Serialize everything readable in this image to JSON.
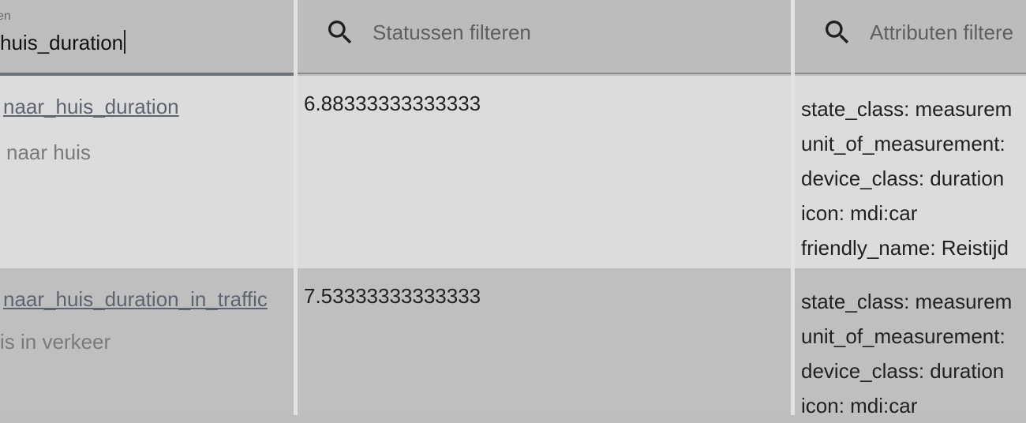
{
  "columns": {
    "entity": {
      "floating_label": "en",
      "filter_value": "huis_duration"
    },
    "state": {
      "filter_placeholder": "Statussen filteren",
      "icon": "search-icon"
    },
    "attributes": {
      "filter_placeholder": "Attributen filtere",
      "icon": "search-icon"
    }
  },
  "rows": [
    {
      "entity_id": "naar_huis_duration",
      "friendly_name": "naar huis",
      "state": "6.88333333333333",
      "attributes": [
        "state_class: measurem",
        "unit_of_measurement:",
        "device_class: duration",
        "icon: mdi:car",
        "friendly_name: Reistijd"
      ]
    },
    {
      "entity_id": "naar_huis_duration_in_traffic",
      "friendly_name": "is in verkeer",
      "state": "7.53333333333333",
      "attributes": [
        "state_class: measurem",
        "unit_of_measurement:",
        "device_class: duration",
        "icon: mdi:car"
      ]
    }
  ]
}
